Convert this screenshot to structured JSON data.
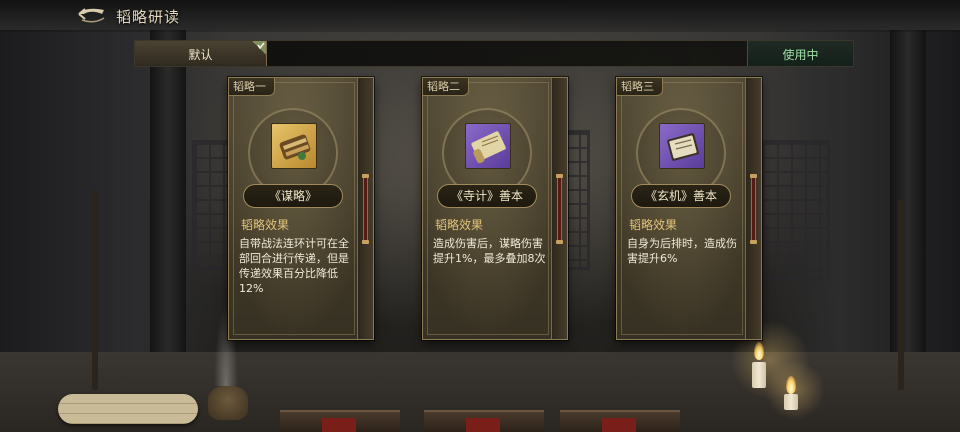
{
  "header": {
    "title": "韬略研读",
    "back_icon": "back-arrow-icon"
  },
  "tabs": {
    "default_label": "默认",
    "status_label": "使用中"
  },
  "cards": [
    {
      "tab": "韬略一",
      "name": "《谋略》",
      "item_color": "gold",
      "effect_label": "韬略效果",
      "effect_text": "自带战法连环计可在全部回合进行传递，但是传递效果百分比降低12%"
    },
    {
      "tab": "韬略二",
      "name": "《寺计》善本",
      "item_color": "purple",
      "effect_label": "韬略效果",
      "effect_text": "造成伤害后，谋略伤害提升1%，最多叠加8次"
    },
    {
      "tab": "韬略三",
      "name": "《玄机》善本",
      "item_color": "purple",
      "effect_label": "韬略效果",
      "effect_text": "自身为后排时，造成伤害提升6%"
    }
  ],
  "colors": {
    "accent_gold": "#e2c27a",
    "status_green": "#9fe0a8",
    "quality_gold": "#e8c46a",
    "quality_purple": "#8a6ac8"
  }
}
